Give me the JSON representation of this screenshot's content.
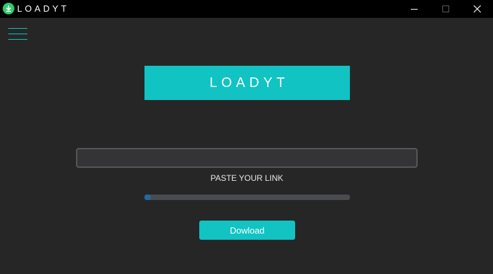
{
  "window": {
    "title": "LOADYT",
    "controls": {
      "minimize": "minimize",
      "maximize": "maximize",
      "close": "close"
    }
  },
  "menu": {
    "icon": "hamburger-menu-icon"
  },
  "header": {
    "logo_text": "LOADYT"
  },
  "link_input": {
    "value": "",
    "placeholder": "",
    "label": "PASTE YOUR LINK"
  },
  "progress": {
    "fraction": 0.03
  },
  "download": {
    "label": "Dowload"
  },
  "colors": {
    "accent": "#11c3c3",
    "background": "#262626",
    "titlebar": "#000000",
    "progress_fill": "#1f6aa5",
    "progress_track": "#4a4b50",
    "app_icon": "#2ecc71"
  }
}
